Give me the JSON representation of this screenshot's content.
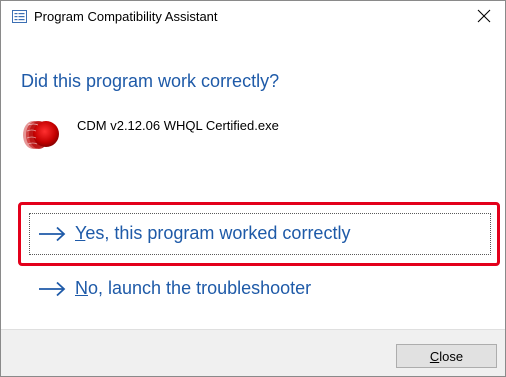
{
  "window": {
    "title": "Program Compatibility Assistant",
    "close_glyph": "✕"
  },
  "dialog": {
    "heading": "Did this program work correctly?",
    "program_name": "CDM v2.12.06 WHQL Certified.exe",
    "program_icon": "red-disc-icon"
  },
  "options": {
    "yes": {
      "mnemonic": "Y",
      "label_rest": "es, this program worked correctly"
    },
    "no": {
      "mnemonic": "N",
      "label_rest": "o, launch the troubleshooter"
    }
  },
  "footer": {
    "close_mnemonic": "C",
    "close_rest": "lose"
  },
  "colors": {
    "link_blue": "#1e5aa8",
    "highlight_red": "#e3001b",
    "footer_bg": "#f0f0f0"
  }
}
